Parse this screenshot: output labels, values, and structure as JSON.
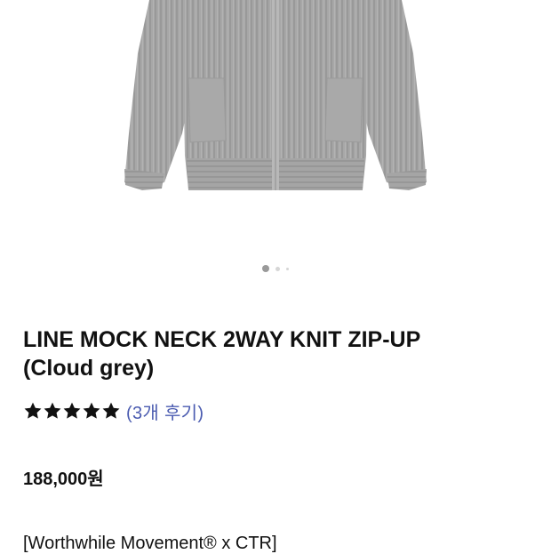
{
  "product": {
    "title_line1": "LINE MOCK NECK 2WAY KNIT ZIP-UP",
    "title_line2": "(Cloud grey)",
    "rating": {
      "stars": 5,
      "max": 5,
      "review_text": "(3개 후기)"
    },
    "price": "188,000원",
    "brand_line": "[Worthwhile Movement® x CTR]"
  },
  "carousel": {
    "slide_count": 3,
    "active_index": 0
  },
  "colors": {
    "link": "#4a5bb0",
    "text": "#111111",
    "garment": "#a9a9a9"
  }
}
